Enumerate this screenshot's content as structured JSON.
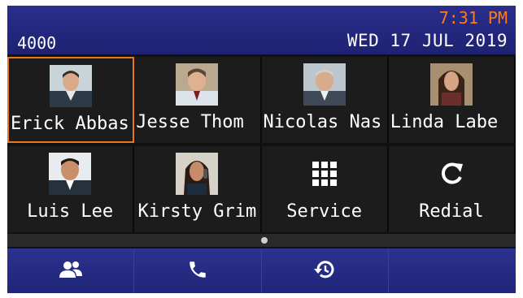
{
  "header": {
    "extension": "4000",
    "time": "7:31 PM",
    "date": "WED 17 JUL 2019",
    "time_color": "#ff7a1a"
  },
  "tiles": [
    {
      "label": "Erick Abbas",
      "type": "contact",
      "selected": true
    },
    {
      "label": "Jesse Thom",
      "type": "contact"
    },
    {
      "label": "Nicolas Nas",
      "type": "contact"
    },
    {
      "label": "Linda Labe",
      "type": "contact"
    },
    {
      "label": "Luis Lee",
      "type": "contact"
    },
    {
      "label": "Kirsty Grim",
      "type": "contact"
    },
    {
      "label": "Service",
      "type": "function",
      "icon": "keypad-grid-icon"
    },
    {
      "label": "Redial",
      "type": "function",
      "icon": "redial-icon"
    }
  ],
  "pager": {
    "current": 1,
    "total": 1
  },
  "bottom_nav": [
    {
      "icon": "contacts-icon"
    },
    {
      "icon": "phone-icon"
    },
    {
      "icon": "history-icon"
    },
    {
      "icon": ""
    }
  ],
  "colors": {
    "header_bg": "#1d2272",
    "selection": "#e8781b",
    "tile_bg": "#1c1c1c"
  }
}
